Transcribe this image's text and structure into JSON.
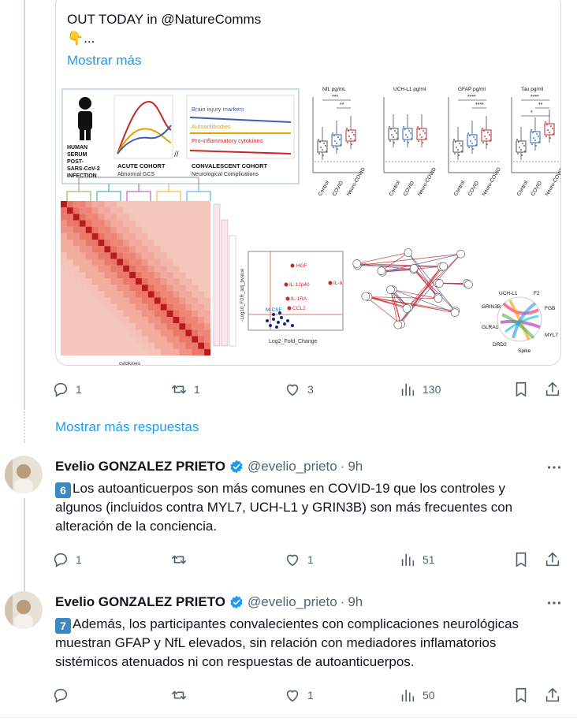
{
  "top_tweet": {
    "text_line1": "OUT TODAY in @NatureComms",
    "text_line2": "👇...",
    "show_more": "Mostrar más",
    "figure": {
      "left_labels": [
        "HUMAN",
        "SERUM",
        "POST-",
        "SARS-CoV-2",
        "INFECTION"
      ],
      "acute_title": "ACUTE COHORT",
      "acute_sub": "Abnormal GCS",
      "conv_title": "CONVALESCENT COHORT",
      "conv_sub": "Neurological Complications",
      "legend": [
        "Brain injury markers",
        "Autoantibodies",
        "Pro-inflammatory cytokines"
      ],
      "boxplots": [
        {
          "title": "NfL pg/mL",
          "sig": [
            "***",
            "**"
          ]
        },
        {
          "title": "UCH-L1 pg/ml",
          "sig": []
        },
        {
          "title": "GFAP pg/ml",
          "sig": [
            "****",
            "****"
          ]
        },
        {
          "title": "Tau pg/ml",
          "sig": [
            "****",
            "**",
            "*"
          ]
        }
      ],
      "groups": [
        "Control",
        "COVID",
        "Neuro-COVID"
      ],
      "heatmap_xlabel": "cytokines",
      "volcano": {
        "ylabel": "−Log10_FDR_adj_pvalue",
        "xlabel": "Log2_Fold_Change",
        "points": [
          "HGF",
          "IL-6",
          "IL-12p40",
          "IL-1RA",
          "CCL2",
          "M-CSF"
        ]
      },
      "chord_labels": [
        "UCH-L1",
        "F2",
        "GRIN3B",
        "FGB",
        "GLRA1",
        "MYL7",
        "DRD2",
        "Spike"
      ]
    },
    "actions": {
      "replies": "1",
      "retweets": "1",
      "likes": "3",
      "views": "130"
    }
  },
  "more_replies": "Mostrar más respuestas",
  "tweets": [
    {
      "name": "Evelio GONZALEZ PRIETO",
      "handle": "@evelio_prieto",
      "time": "9h",
      "keycap": "6",
      "line1": "Los autoanticuerpos son más comunes en COVID-19 que los controles y",
      "line2": "algunos (incluidos contra MYL7, UCH-L1 y GRIN3B) son más frecuentes con",
      "line3": "alteración de la conciencia.",
      "actions": {
        "replies": "1",
        "retweets": "",
        "likes": "1",
        "views": "51"
      }
    },
    {
      "name": "Evelio GONZALEZ PRIETO",
      "handle": "@evelio_prieto",
      "time": "9h",
      "keycap": "7",
      "line1": "Además, los participantes convalecientes con complicaciones neurológicas",
      "line2": "muestran GFAP y NfL elevados, sin relación con mediadores inflamatorios",
      "line3": "sistémicos atenuados ni con respuestas de autoanticuerpos.",
      "actions": {
        "replies": "",
        "retweets": "",
        "likes": "1",
        "views": "50"
      }
    }
  ],
  "colors": {
    "accent": "#1d9bf0",
    "muted": "#536471",
    "verified": "#1d9bf0"
  }
}
